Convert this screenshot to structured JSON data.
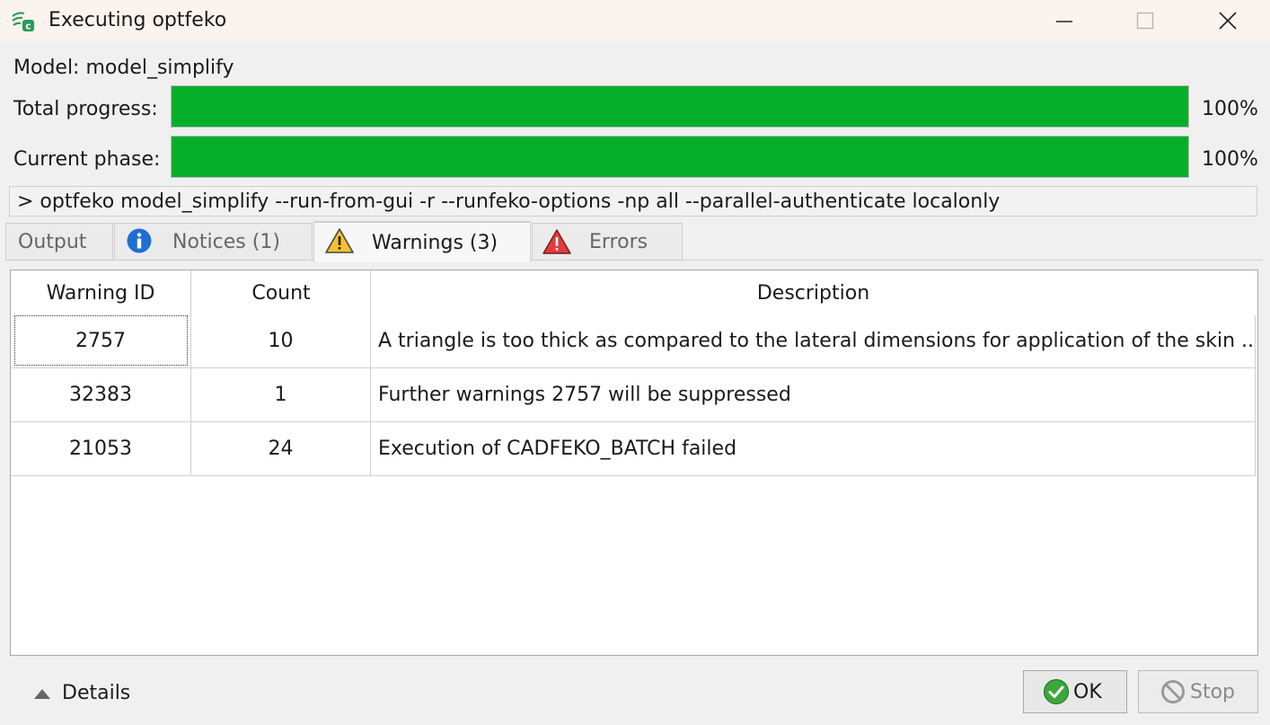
{
  "window": {
    "title": "Executing optfeko",
    "controls": {
      "minimize_icon": "minimize-icon",
      "maximize_icon": "maximize-icon",
      "close_icon": "close-icon"
    }
  },
  "model": {
    "label": "Model: model_simplify"
  },
  "progress": {
    "total": {
      "label": "Total progress:",
      "percent_text": "100%",
      "fraction": 1.0
    },
    "phase": {
      "label": "Current phase:",
      "percent_text": "100%",
      "fraction": 1.0
    },
    "fill_color": "#06af2a"
  },
  "command": {
    "text": "> optfeko model_simplify --run-from-gui -r --runfeko-options -np all --parallel-authenticate localonly"
  },
  "tabs": [
    {
      "label": "Output",
      "icon": "",
      "active": false
    },
    {
      "label": "Notices (1)",
      "icon": "info-icon",
      "active": false
    },
    {
      "label": "Warnings (3)",
      "icon": "warning-icon",
      "active": true
    },
    {
      "label": "Errors",
      "icon": "error-icon",
      "active": false
    }
  ],
  "table": {
    "headers": [
      "Warning ID",
      "Count",
      "Description"
    ],
    "rows": [
      {
        "id": "2757",
        "count": "10",
        "description": "A triangle is too thick as compared to the lateral dimensions for application of the skin ..."
      },
      {
        "id": "32383",
        "count": "1",
        "description": "Further warnings 2757 will be suppressed"
      },
      {
        "id": "21053",
        "count": "24",
        "description": "Execution of CADFEKO_BATCH failed"
      }
    ]
  },
  "footer": {
    "details_label": "Details",
    "ok_label": "OK",
    "stop_label": "Stop"
  },
  "colors": {
    "accent": "#5aa7e6",
    "success": "#06af2a",
    "warning": "#f2c12e",
    "error": "#e23b3b",
    "info": "#1f6fd1"
  }
}
